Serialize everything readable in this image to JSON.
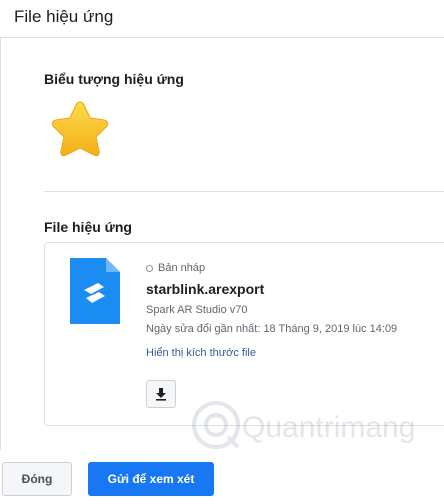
{
  "dialog": {
    "title": "File hiệu ứng"
  },
  "effect_icon_section": {
    "title": "Biểu tượng hiệu ứng",
    "icon": "star-icon"
  },
  "effect_file_section": {
    "title": "File hiệu ứng",
    "file": {
      "icon": "spark-ar-file-icon",
      "status": "Bản nháp",
      "name": "starblink.arexport",
      "app": "Spark AR Studio v70",
      "modified": "Ngày sửa đổi gần nhất: 18 Tháng 9, 2019 lúc 14:09",
      "size_link": "Hiển thị kích thước file",
      "download_icon": "download-icon"
    }
  },
  "watermark": {
    "text": "Quantrimang"
  },
  "footer": {
    "close_label": "Đóng",
    "submit_label": "Gửi để xem xét"
  },
  "colors": {
    "primary": "#1877f2",
    "link": "#385898",
    "star": "#f7c21c",
    "file_icon": "#1b8cf2"
  }
}
